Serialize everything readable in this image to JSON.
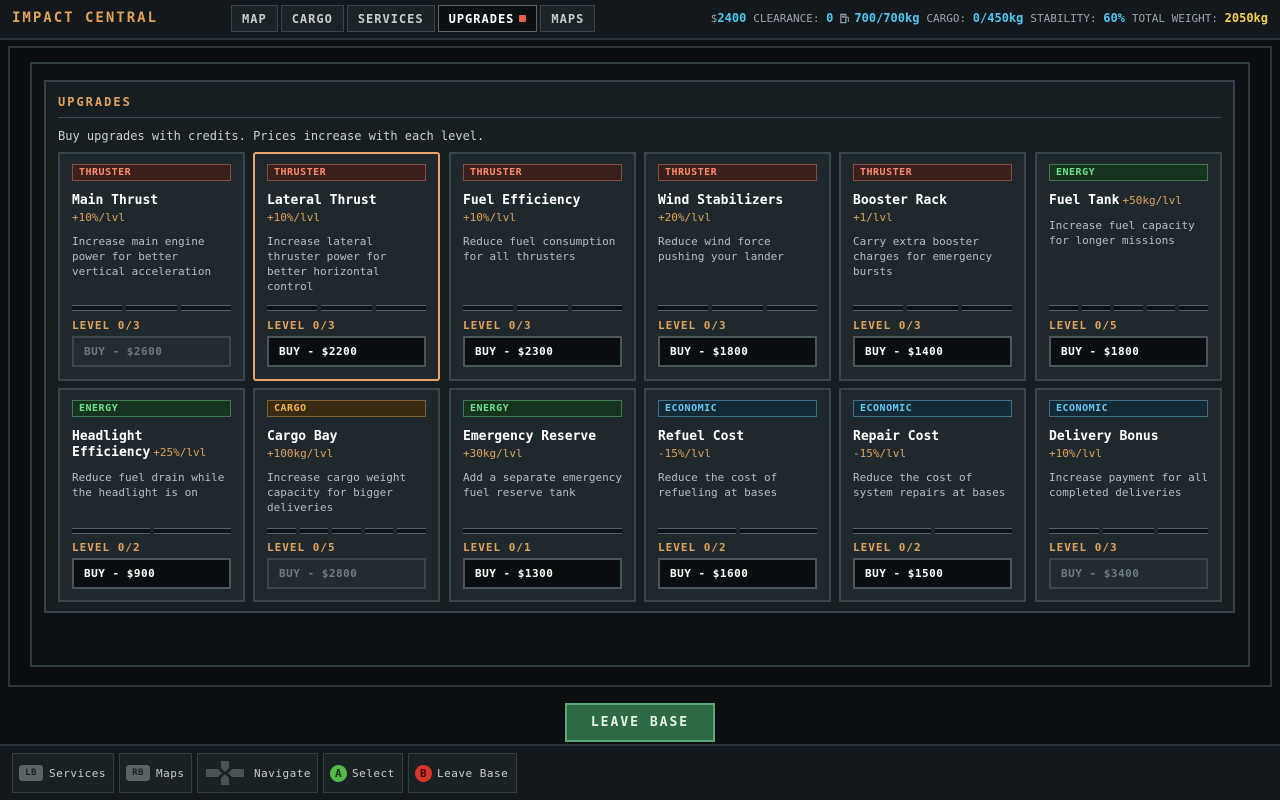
{
  "header": {
    "title": "IMPACT CENTRAL",
    "tabs": [
      {
        "label": "MAP",
        "active": false
      },
      {
        "label": "CARGO",
        "active": false
      },
      {
        "label": "SERVICES",
        "active": false
      },
      {
        "label": "UPGRADES",
        "active": true
      },
      {
        "label": "MAPS",
        "active": false
      }
    ],
    "stats": {
      "credits_symbol": "$",
      "credits": "2400",
      "clearance_label": "CLEARANCE:",
      "clearance": "0",
      "fuel": "700/700kg",
      "cargo_label": "CARGO:",
      "cargo": "0/450kg",
      "stability_label": "STABILITY:",
      "stability": "60%",
      "weight_label": "TOTAL WEIGHT:",
      "weight": "2050kg"
    }
  },
  "panel": {
    "title": "UPGRADES",
    "subtitle": "Buy upgrades with credits. Prices increase with each level."
  },
  "upgrades": [
    {
      "category": "THRUSTER",
      "cat": "thruster",
      "name": "Main Thrust",
      "bonus": "+10%/lvl",
      "inline": false,
      "desc": "Increase main engine power for better vertical acceleration",
      "segments": 3,
      "filled": 0,
      "level": "LEVEL 0/3",
      "buy": "BUY - $2600",
      "disabled": true,
      "selected": false
    },
    {
      "category": "THRUSTER",
      "cat": "thruster",
      "name": "Lateral Thrust",
      "bonus": "+10%/lvl",
      "inline": false,
      "desc": "Increase lateral thruster power for better horizontal control",
      "segments": 3,
      "filled": 0,
      "level": "LEVEL 0/3",
      "buy": "BUY - $2200",
      "disabled": false,
      "selected": true
    },
    {
      "category": "THRUSTER",
      "cat": "thruster",
      "name": "Fuel Efficiency",
      "bonus": "+10%/lvl",
      "inline": false,
      "desc": "Reduce fuel consumption for all thrusters",
      "segments": 3,
      "filled": 0,
      "level": "LEVEL 0/3",
      "buy": "BUY - $2300",
      "disabled": false,
      "selected": false
    },
    {
      "category": "THRUSTER",
      "cat": "thruster",
      "name": "Wind Stabilizers",
      "bonus": "+20%/lvl",
      "inline": false,
      "desc": "Reduce wind force pushing your lander",
      "segments": 3,
      "filled": 0,
      "level": "LEVEL 0/3",
      "buy": "BUY - $1800",
      "disabled": false,
      "selected": false
    },
    {
      "category": "THRUSTER",
      "cat": "thruster",
      "name": "Booster Rack",
      "bonus": "+1/lvl",
      "inline": false,
      "desc": "Carry extra booster charges for emergency bursts",
      "segments": 3,
      "filled": 0,
      "level": "LEVEL 0/3",
      "buy": "BUY - $1400",
      "disabled": false,
      "selected": false
    },
    {
      "category": "ENERGY",
      "cat": "energy",
      "name": "Fuel Tank",
      "bonus": "+50kg/lvl",
      "inline": true,
      "desc": "Increase fuel capacity for longer missions",
      "segments": 5,
      "filled": 0,
      "level": "LEVEL 0/5",
      "buy": "BUY - $1800",
      "disabled": false,
      "selected": false
    },
    {
      "category": "ENERGY",
      "cat": "energy",
      "name": "Headlight Efficiency",
      "bonus": "+25%/lvl",
      "inline": true,
      "desc": "Reduce fuel drain while the headlight is on",
      "segments": 2,
      "filled": 0,
      "level": "LEVEL 0/2",
      "buy": "BUY - $900",
      "disabled": false,
      "selected": false
    },
    {
      "category": "CARGO",
      "cat": "cargo",
      "name": "Cargo Bay",
      "bonus": "+100kg/lvl",
      "inline": false,
      "desc": "Increase cargo weight capacity for bigger deliveries",
      "segments": 5,
      "filled": 0,
      "level": "LEVEL 0/5",
      "buy": "BUY - $2800",
      "disabled": true,
      "selected": false
    },
    {
      "category": "ENERGY",
      "cat": "energy",
      "name": "Emergency Reserve",
      "bonus": "+30kg/lvl",
      "inline": false,
      "desc": "Add a separate emergency fuel reserve tank",
      "segments": 1,
      "filled": 0,
      "level": "LEVEL 0/1",
      "buy": "BUY - $1300",
      "disabled": false,
      "selected": false
    },
    {
      "category": "ECONOMIC",
      "cat": "economic",
      "name": "Refuel Cost",
      "bonus": "-15%/lvl",
      "inline": false,
      "desc": "Reduce the cost of refueling at bases",
      "segments": 2,
      "filled": 0,
      "level": "LEVEL 0/2",
      "buy": "BUY - $1600",
      "disabled": false,
      "selected": false
    },
    {
      "category": "ECONOMIC",
      "cat": "economic",
      "name": "Repair Cost",
      "bonus": "-15%/lvl",
      "inline": false,
      "desc": "Reduce the cost of system repairs at bases",
      "segments": 2,
      "filled": 0,
      "level": "LEVEL 0/2",
      "buy": "BUY - $1500",
      "disabled": false,
      "selected": false
    },
    {
      "category": "ECONOMIC",
      "cat": "economic",
      "name": "Delivery Bonus",
      "bonus": "+10%/lvl",
      "inline": false,
      "desc": "Increase payment for all completed deliveries",
      "segments": 3,
      "filled": 0,
      "level": "LEVEL 0/3",
      "buy": "BUY - $3400",
      "disabled": true,
      "selected": false
    }
  ],
  "leave_button": "LEAVE BASE",
  "footer": {
    "hints": [
      {
        "key": "LB",
        "label": "Services"
      },
      {
        "key": "RB",
        "label": "Maps"
      },
      {
        "key": "dpad",
        "label": "Navigate"
      },
      {
        "key": "A",
        "label": "Select"
      },
      {
        "key": "B",
        "label": "Leave Base"
      }
    ]
  }
}
